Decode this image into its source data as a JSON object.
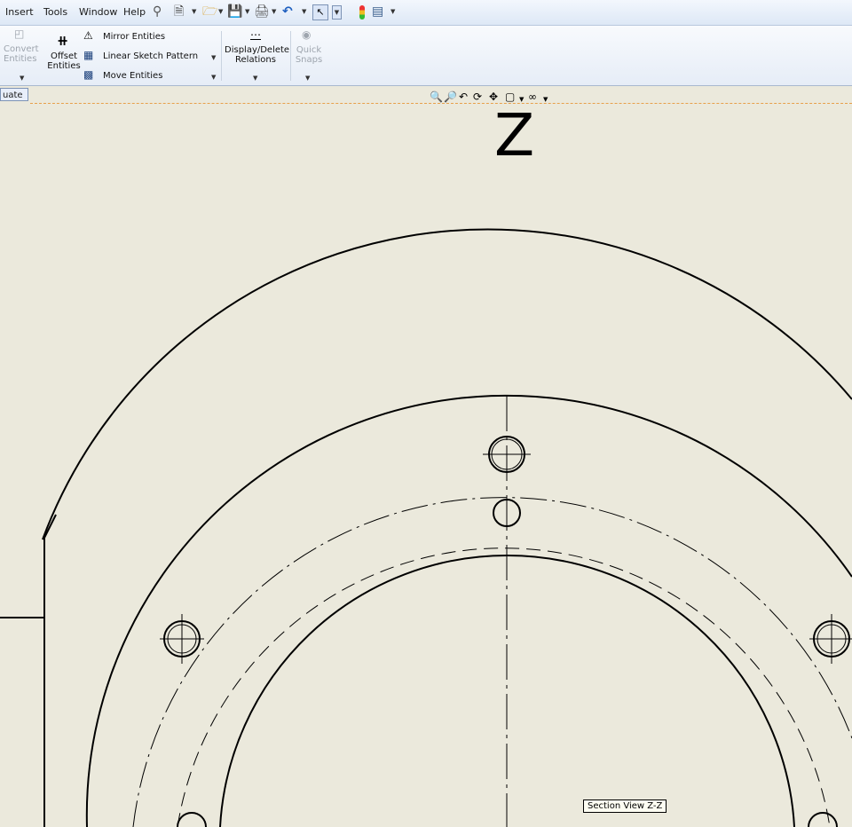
{
  "menu": {
    "items": [
      "Insert",
      "Tools",
      "Window",
      "Help"
    ]
  },
  "toolbar": {
    "icons": [
      "pin-icon",
      "new-document-icon",
      "open-folder-icon",
      "save-icon",
      "print-icon",
      "undo-icon",
      "select-arrow-icon",
      "rebuild-traffic-light-icon",
      "options-icon"
    ]
  },
  "ribbon": {
    "convert_entities": [
      "Convert",
      "Entities"
    ],
    "offset_entities": [
      "Offset",
      "Entities"
    ],
    "mirror_entities": "Mirror Entities",
    "linear_sketch_pattern": "Linear Sketch Pattern",
    "move_entities": "Move Entities",
    "display_delete_relations": [
      "Display/Delete",
      "Relations"
    ],
    "quick_snaps": [
      "Quick",
      "Snaps"
    ]
  },
  "feature_tab": {
    "label": "uate"
  },
  "view": {
    "label": "Z",
    "tooltip": "Section View Z-Z"
  },
  "colors": {
    "accent": "#e8a04a",
    "canvas": "#ebe9dc",
    "ink": "#000000"
  }
}
